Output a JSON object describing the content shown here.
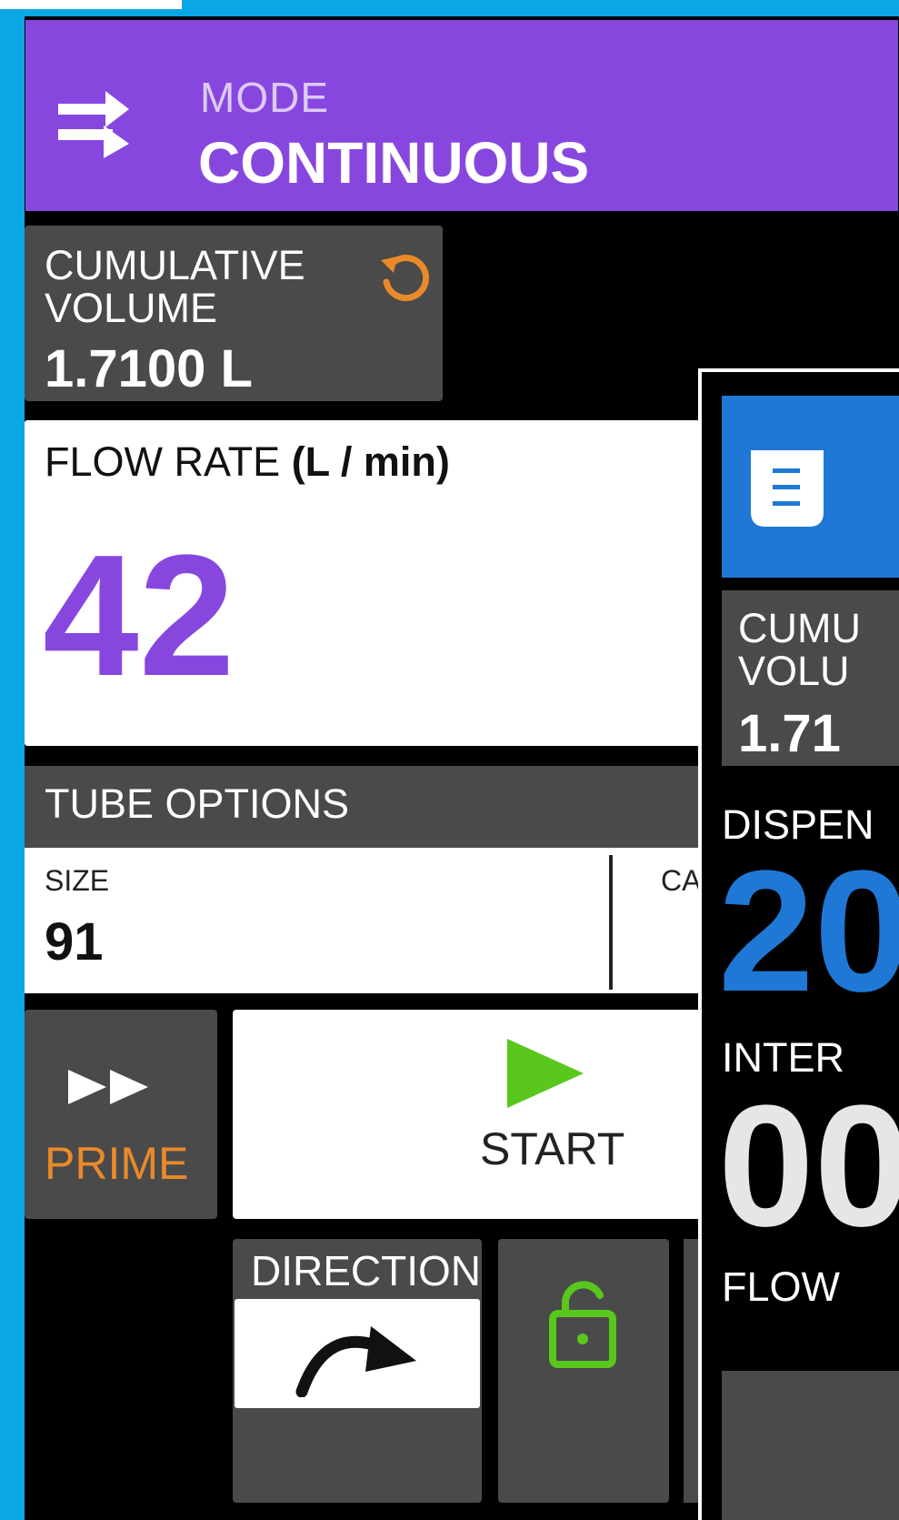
{
  "mode": {
    "label": "MODE",
    "value": "CONTINUOUS",
    "color": "#8747df"
  },
  "cumulative": {
    "label": "CUMULATIVE VOLUME",
    "value": "1.7100 L"
  },
  "flow_rate": {
    "label": "FLOW RATE",
    "unit": "(L / min)",
    "value": "42"
  },
  "tube_options": {
    "title": "TUBE OPTIONS",
    "size_label": "SIZE",
    "size_value": "91",
    "second_label_partial": "CA"
  },
  "prime": {
    "label": "PRIME",
    "color": "#e98a2a"
  },
  "start": {
    "label": "START",
    "color": "#59c71c"
  },
  "direction": {
    "label": "DIRECTION"
  },
  "lock": {
    "state": "unlocked",
    "color": "#59c71c"
  },
  "overlay": {
    "header_color": "#1f78d6",
    "cumulative_label": "CUMU\nVOLU",
    "cumulative_value": "1.71",
    "dispense_label": "DISPEN",
    "dispense_value": "20",
    "interval_label": "INTER",
    "interval_value": "00",
    "flow_label": "FLOW"
  },
  "icons": {
    "mode": "swap-arrows-icon",
    "reset": "reset-icon",
    "prime": "fast-forward-icon",
    "start": "play-icon",
    "direction": "clockwise-arrow-icon",
    "lock": "unlock-icon",
    "overlay_mode": "document-icon"
  }
}
